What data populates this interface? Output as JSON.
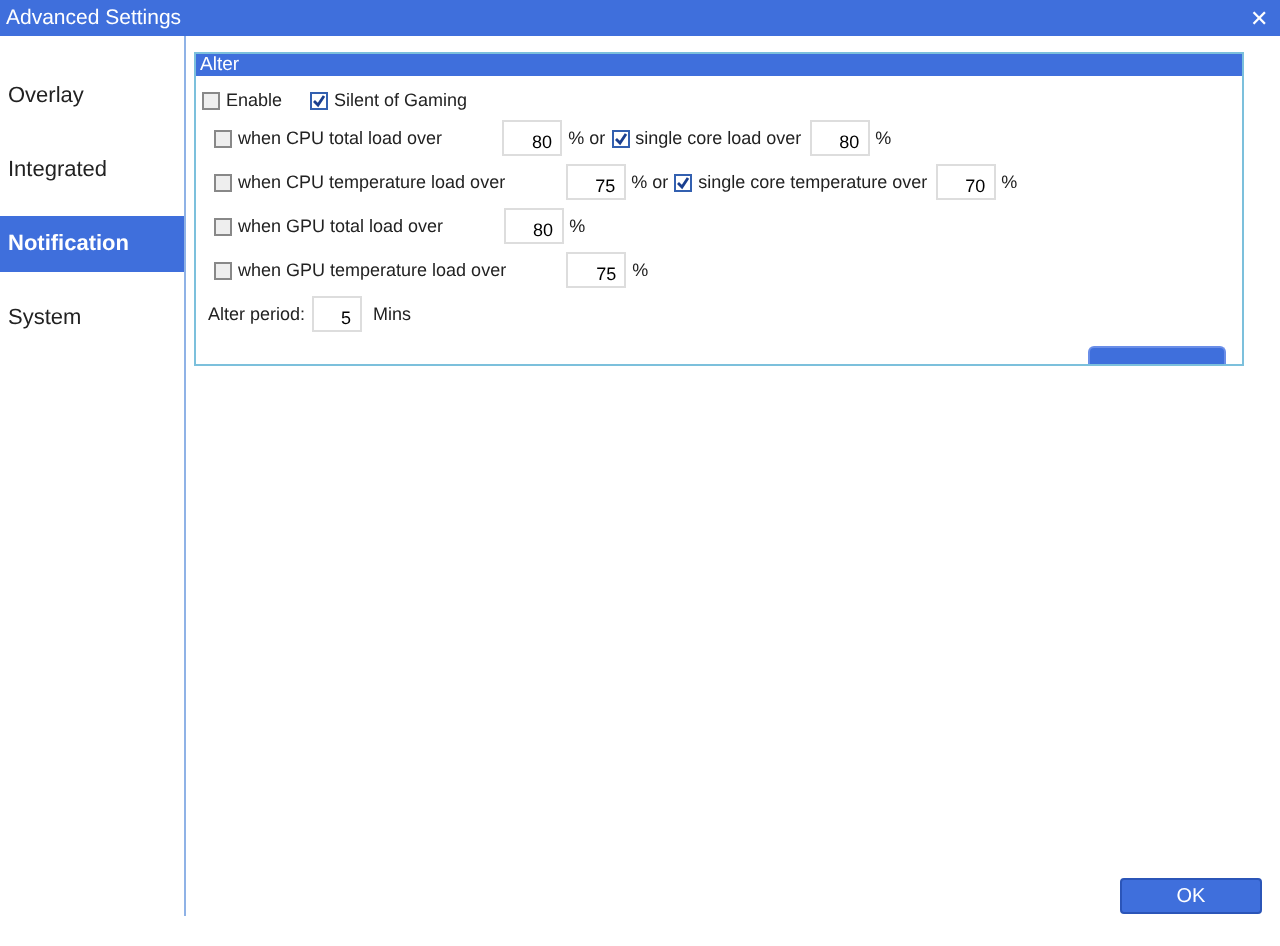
{
  "window": {
    "title": "Advanced Settings",
    "close": "✕"
  },
  "sidebar": {
    "items": [
      {
        "label": "Overlay",
        "selected": false
      },
      {
        "label": "Integrated",
        "selected": false
      },
      {
        "label": "Notification",
        "selected": true
      },
      {
        "label": "System",
        "selected": false
      }
    ]
  },
  "alter": {
    "title": "Alter",
    "enable": {
      "label": "Enable",
      "checked": false
    },
    "silent": {
      "label": "Silent of Gaming",
      "checked": true
    },
    "rules": [
      {
        "label": "when CPU total load over",
        "checked": false,
        "value": "80",
        "suffix": "% or",
        "extra": {
          "label": "single core load over",
          "checked": true,
          "value": "80",
          "suffix": "%"
        }
      },
      {
        "label": "when CPU temperature load over",
        "checked": false,
        "value": "75",
        "suffix": "% or",
        "extra": {
          "label": "single core temperature over",
          "checked": true,
          "value": "70",
          "suffix": "%"
        }
      },
      {
        "label": "when GPU total load over",
        "checked": false,
        "value": "80",
        "suffix": "%"
      },
      {
        "label": "when GPU temperature load over",
        "checked": false,
        "value": "75",
        "suffix": "%"
      }
    ],
    "period": {
      "label": "Alter period:",
      "value": "5",
      "unit": "Mins"
    }
  },
  "buttons": [
    {
      "label": "OK"
    }
  ]
}
